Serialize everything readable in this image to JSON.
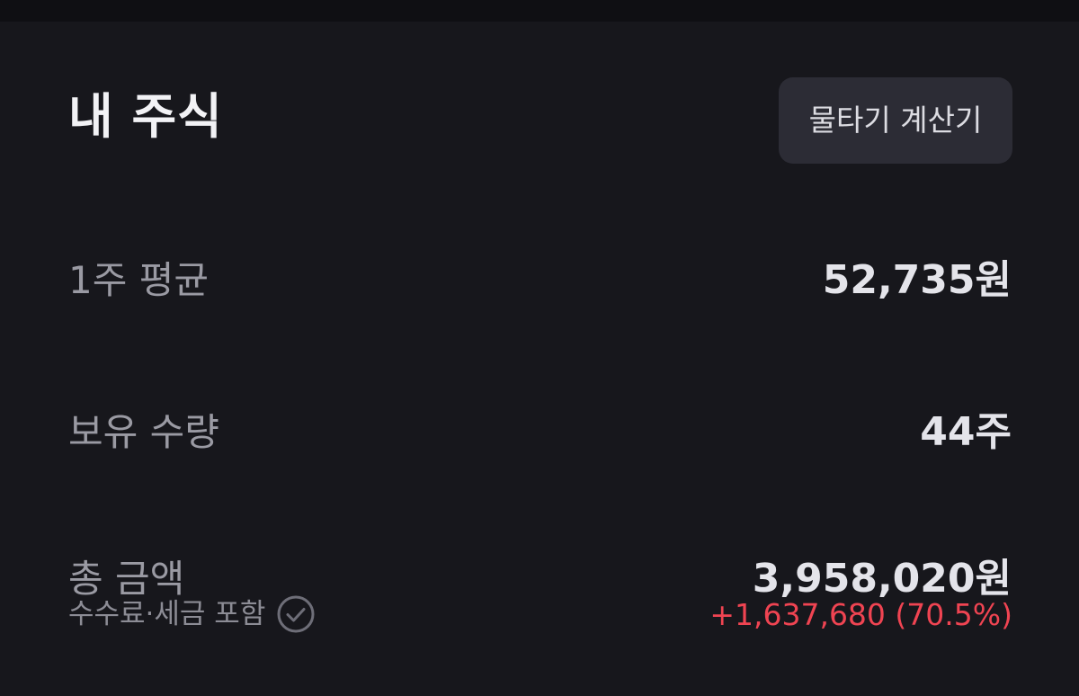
{
  "section": {
    "title": "내 주식",
    "calculator_button": "물타기 계산기"
  },
  "rows": [
    {
      "label": "1주 평균",
      "value": "52,735원"
    },
    {
      "label": "보유 수량",
      "value": "44주"
    },
    {
      "label": "총 금액",
      "value": "3,958,020원"
    }
  ],
  "total": {
    "fee_note": "수수료·세금 포함",
    "profit": "+1,637,680 (70.5%)"
  },
  "colors": {
    "background": "#17171c",
    "button_bg": "#2c2c35",
    "profit_red": "#f04452"
  },
  "icons": {
    "fee_info": "check-circle-icon"
  }
}
